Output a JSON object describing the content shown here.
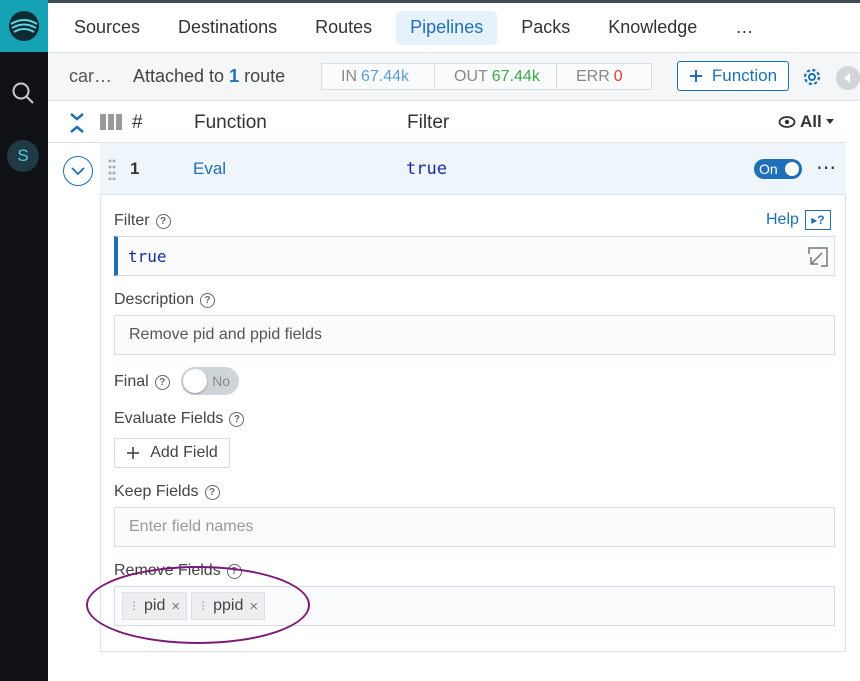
{
  "nav": {
    "tabs": [
      "Sources",
      "Destinations",
      "Routes",
      "Pipelines",
      "Packs",
      "Knowledge"
    ],
    "more": "…",
    "active": "Pipelines"
  },
  "rail": {
    "avatar": "S"
  },
  "pipeline": {
    "name": "car…",
    "attached_prefix": "Attached to ",
    "attached_count": "1",
    "attached_suffix": " route",
    "stats": {
      "in_label": "IN",
      "in_value": "67.44k",
      "out_label": "OUT",
      "out_value": "67.44k",
      "err_label": "ERR",
      "err_value": "0"
    },
    "add_function": "Function"
  },
  "table": {
    "col_hash": "#",
    "col_function": "Function",
    "col_filter": "Filter",
    "view": "All"
  },
  "row": {
    "num": "1",
    "function": "Eval",
    "filter": "true",
    "toggle": "On",
    "menu": "⋯"
  },
  "panel": {
    "filter_label": "Filter",
    "help": "Help",
    "filter_value": "true",
    "description_label": "Description",
    "description_value": "Remove pid and ppid fields",
    "final_label": "Final",
    "final_toggle": "No",
    "evaluate_label": "Evaluate Fields",
    "add_field": "Add Field",
    "keep_label": "Keep Fields",
    "keep_placeholder": "Enter field names",
    "remove_label": "Remove Fields",
    "remove_tags": [
      {
        "name": "pid"
      },
      {
        "name": "ppid"
      }
    ]
  }
}
